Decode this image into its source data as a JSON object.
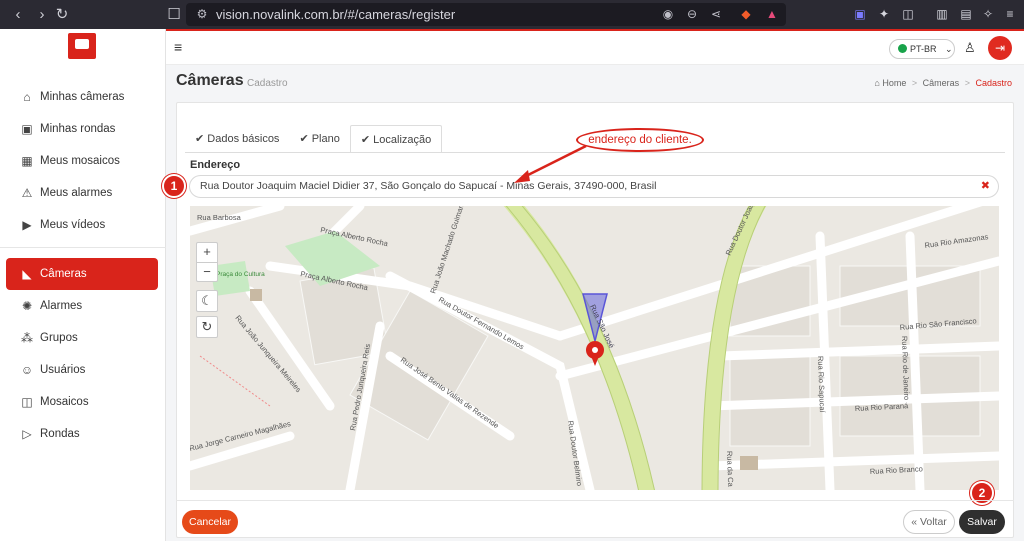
{
  "browser": {
    "url": "vision.novalink.com.br/#/cameras/register"
  },
  "sidebar": {
    "items": [
      {
        "label": "Minhas câmeras",
        "icon": "home-icon"
      },
      {
        "label": "Minhas rondas",
        "icon": "ronda-icon"
      },
      {
        "label": "Meus mosaicos",
        "icon": "grid-icon"
      },
      {
        "label": "Meus alarmes",
        "icon": "alarm-icon"
      },
      {
        "label": "Meus vídeos",
        "icon": "play-icon"
      },
      {
        "label": "Câmeras",
        "icon": "camera-icon",
        "active": true
      },
      {
        "label": "Alarmes",
        "icon": "siren-icon"
      },
      {
        "label": "Grupos",
        "icon": "groups-icon"
      },
      {
        "label": "Usuários",
        "icon": "users-icon"
      },
      {
        "label": "Mosaicos",
        "icon": "mosaic-icon"
      },
      {
        "label": "Rondas",
        "icon": "rondas-icon"
      }
    ]
  },
  "header": {
    "language": "PT-BR"
  },
  "page": {
    "title": "Câmeras",
    "subtitle": "Cadastro",
    "breadcrumb": [
      "Home",
      "Câmeras",
      "Cadastro"
    ]
  },
  "tabs": [
    {
      "label": "Dados básicos"
    },
    {
      "label": "Plano"
    },
    {
      "label": "Localização",
      "active": true
    }
  ],
  "form": {
    "address_label": "Endereço",
    "address_value": "Rua Doutor Joaquim Maciel Didier 37, São Gonçalo do Sapucaí - Minas Gerais, 37490-000, Brasil"
  },
  "map": {
    "streets": [
      "Rua Barbosa",
      "Praça Alberto Rocha",
      "Praça Alberto Rocha",
      "Praça do Cultura",
      "Rua João Machado Guimarães",
      "Rua Doutor Fernando Lemos",
      "Rua João Junqueira Meireles",
      "Rua Pedro Junqueira Reis",
      "Rua José Bento Valias de Rezende",
      "Rua Doutor Belmiro",
      "Rua São José",
      "Rua Doutor Joaq",
      "Rua Rio Amazonas",
      "Rua Rio São Francisco",
      "Rua Rio Sapucaí",
      "Rua Rio de Janeiro",
      "Rua Rio Paraná",
      "Rua Rio Branco",
      "Rua da Ca",
      "Rua Jorge Carneiro Magalhães"
    ],
    "controls": [
      "+",
      "−"
    ]
  },
  "annotations": {
    "callout": "endereço do cliente.",
    "badge1": "1",
    "badge2": "2"
  },
  "buttons": {
    "cancel": "Cancelar",
    "back": "« Voltar",
    "save": "Salvar"
  },
  "colors": {
    "accent": "#d9241b",
    "sidebar_active": "#d9241b",
    "save_button": "#2f2f2f"
  }
}
